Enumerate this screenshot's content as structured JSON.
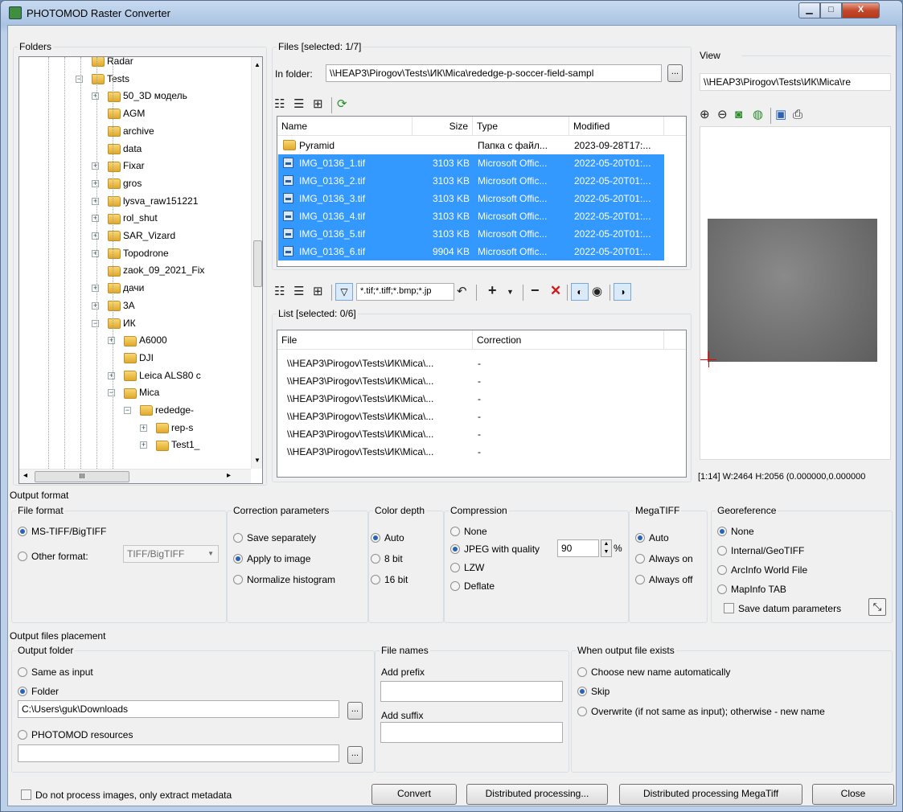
{
  "title": "PHOTOMOD Raster Converter",
  "window_controls": {
    "minimize": "▁",
    "maximize": "□",
    "close": "X"
  },
  "folders": {
    "label": "Folders",
    "items": [
      "Radar",
      "Tests",
      "50_3D модель",
      "AGM",
      "archive",
      "data",
      "Fixar",
      "gros",
      "lysva_raw151221",
      "rol_shut",
      "SAR_Vizard",
      "Topodrone",
      "zaok_09_2021_Fix",
      "дачи",
      "3A",
      "ИК",
      "A6000",
      "DJI",
      "Leica ALS80 с",
      "Mica",
      "rededge-",
      "rep-s",
      "Test1_"
    ],
    "scroll_left": "◂",
    "scroll_right": "▸",
    "scroll_thumb": "III"
  },
  "files": {
    "label": "Files [selected: 1/7]",
    "in_folder_label": "In folder:",
    "in_folder_value": "\\\\HEAP3\\Pirogov\\Tests\\ИК\\Mica\\rededge-p-soccer-field-sampl",
    "browse": "...",
    "columns": [
      "Name",
      "Size",
      "Type",
      "Modified"
    ],
    "rows": [
      {
        "name": "Pyramid",
        "size": "",
        "type": "Папка с файл...",
        "modified": "2023-09-28T17:..."
      },
      {
        "name": "IMG_0136_1.tif",
        "size": "3103 KB",
        "type": "Microsoft Offic...",
        "modified": "2022-05-20T01:..."
      },
      {
        "name": "IMG_0136_2.tif",
        "size": "3103 KB",
        "type": "Microsoft Offic...",
        "modified": "2022-05-20T01:..."
      },
      {
        "name": "IMG_0136_3.tif",
        "size": "3103 KB",
        "type": "Microsoft Offic...",
        "modified": "2022-05-20T01:..."
      },
      {
        "name": "IMG_0136_4.tif",
        "size": "3103 KB",
        "type": "Microsoft Offic...",
        "modified": "2022-05-20T01:..."
      },
      {
        "name": "IMG_0136_5.tif",
        "size": "3103 KB",
        "type": "Microsoft Offic...",
        "modified": "2022-05-20T01:..."
      },
      {
        "name": "IMG_0136_6.tif",
        "size": "9904 KB",
        "type": "Microsoft Offic...",
        "modified": "2022-05-20T01:..."
      }
    ]
  },
  "filter_value": "*.tif;*.tiff;*.bmp;*.jp",
  "list": {
    "label": "List [selected: 0/6]",
    "columns": [
      "File",
      "Correction"
    ],
    "rows": [
      {
        "file": "\\\\HEAP3\\Pirogov\\Tests\\ИК\\Mica\\...",
        "correction": "-"
      },
      {
        "file": "\\\\HEAP3\\Pirogov\\Tests\\ИК\\Mica\\...",
        "correction": "-"
      },
      {
        "file": "\\\\HEAP3\\Pirogov\\Tests\\ИК\\Mica\\...",
        "correction": "-"
      },
      {
        "file": "\\\\HEAP3\\Pirogov\\Tests\\ИК\\Mica\\...",
        "correction": "-"
      },
      {
        "file": "\\\\HEAP3\\Pirogov\\Tests\\ИК\\Mica\\...",
        "correction": "-"
      },
      {
        "file": "\\\\HEAP3\\Pirogov\\Tests\\ИК\\Mica\\...",
        "correction": "-"
      }
    ]
  },
  "view": {
    "label": "View",
    "path": "\\\\HEAP3\\Pirogov\\Tests\\ИК\\Mica\\re",
    "status": "[1:14] W:2464 H:2056 (0.000000,0.000000"
  },
  "output_format": {
    "label": "Output format",
    "file_format": {
      "label": "File format",
      "opt1": "MS-TIFF/BigTIFF",
      "opt2": "Other format:",
      "other_value": "TIFF/BigTIFF"
    },
    "correction": {
      "label": "Correction parameters",
      "opts": [
        "Save separately",
        "Apply to image",
        "Normalize histogram"
      ]
    },
    "color_depth": {
      "label": "Color depth",
      "opts": [
        "Auto",
        "8 bit",
        "16 bit"
      ]
    },
    "compression": {
      "label": "Compression",
      "opts": [
        "None",
        "JPEG with quality",
        "LZW",
        "Deflate"
      ],
      "quality": "90",
      "percent": "%"
    },
    "megatiff": {
      "label": "MegaTIFF",
      "opts": [
        "Auto",
        "Always on",
        "Always off"
      ]
    },
    "georef": {
      "label": "Georeference",
      "opts": [
        "None",
        "Internal/GeoTIFF",
        "ArcInfo World File",
        "MapInfo TAB"
      ],
      "save_datum": "Save datum parameters"
    }
  },
  "placement": {
    "label": "Output files placement",
    "output_folder": {
      "label": "Output folder",
      "same": "Same as input",
      "folder": "Folder",
      "folder_value": "C:\\Users\\guk\\Downloads",
      "resources": "PHOTOMOD resources",
      "resources_value": ""
    },
    "file_names": {
      "label": "File names",
      "prefix_label": "Add prefix",
      "prefix_value": "",
      "suffix_label": "Add suffix",
      "suffix_value": ""
    },
    "exists": {
      "label": "When output file exists",
      "opts": [
        "Choose new name automatically",
        "Skip",
        "Overwrite (if not same as input); otherwise - new name"
      ]
    }
  },
  "bottom": {
    "metadata_only": "Do not process images, only extract metadata",
    "convert": "Convert",
    "distributed": "Distributed processing...",
    "distributed_mega": "Distributed processing MegaTiff",
    "close": "Close"
  }
}
